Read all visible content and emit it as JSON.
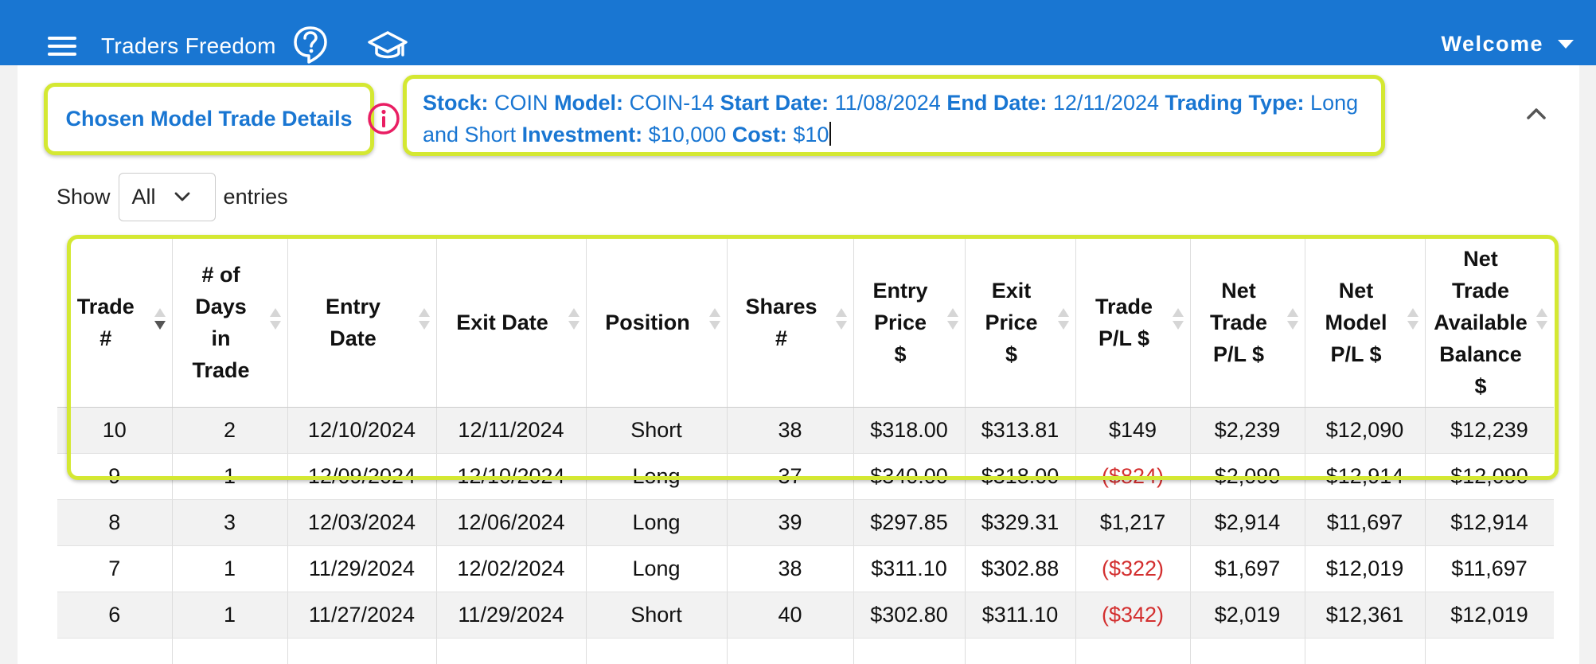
{
  "app": {
    "title": "Traders Freedom",
    "welcome": "Welcome",
    "accent": "#1976d2",
    "highlight": "#d4e832",
    "icons": [
      "menu-icon",
      "help-circle-icon",
      "school-icon",
      "chevron-down-icon",
      "info-icon",
      "chevron-up-icon"
    ]
  },
  "details": {
    "section_title": "Chosen Model Trade Details",
    "stock_label": "Stock:",
    "stock": "COIN",
    "model_label": "Model:",
    "model": "COIN-14",
    "start_label": "Start Date:",
    "start": "11/08/2024",
    "end_label": "End Date:",
    "end": "12/11/2024",
    "type_label": "Trading Type:",
    "type": "Long and Short",
    "investment_label": "Investment:",
    "investment": "$10,000",
    "cost_label": "Cost:",
    "cost": "$10"
  },
  "entries": {
    "show_label": "Show",
    "selected": "All",
    "entries_label": "entries"
  },
  "table": {
    "headers": [
      [
        "Trade",
        "#"
      ],
      [
        "# of",
        "Days",
        "in",
        "Trade"
      ],
      [
        "Entry",
        "Date"
      ],
      [
        "Exit Date"
      ],
      [
        "Position"
      ],
      [
        "Shares",
        "#"
      ],
      [
        "Entry",
        "Price",
        "$"
      ],
      [
        "Exit",
        "Price",
        "$"
      ],
      [
        "Trade",
        "P/L $"
      ],
      [
        "Net",
        "Trade",
        "P/L $"
      ],
      [
        "Net",
        "Model",
        "P/L $"
      ],
      [
        "Net",
        "Trade",
        "Available",
        "Balance",
        "$"
      ]
    ],
    "rows": [
      [
        "10",
        "2",
        "12/10/2024",
        "12/11/2024",
        "Short",
        "38",
        "$318.00",
        "$313.81",
        "$149",
        "$2,239",
        "$12,090",
        "$12,239"
      ],
      [
        "9",
        "1",
        "12/09/2024",
        "12/10/2024",
        "Long",
        "37",
        "$340.00",
        "$318.00",
        "($824)",
        "$2,090",
        "$12,914",
        "$12,090"
      ],
      [
        "8",
        "3",
        "12/03/2024",
        "12/06/2024",
        "Long",
        "39",
        "$297.85",
        "$329.31",
        "$1,217",
        "$2,914",
        "$11,697",
        "$12,914"
      ],
      [
        "7",
        "1",
        "11/29/2024",
        "12/02/2024",
        "Long",
        "38",
        "$311.10",
        "$302.88",
        "($322)",
        "$1,697",
        "$12,019",
        "$11,697"
      ],
      [
        "6",
        "1",
        "11/27/2024",
        "11/29/2024",
        "Short",
        "40",
        "$302.80",
        "$311.10",
        "($342)",
        "$2,019",
        "$12,361",
        "$12,019"
      ]
    ]
  }
}
